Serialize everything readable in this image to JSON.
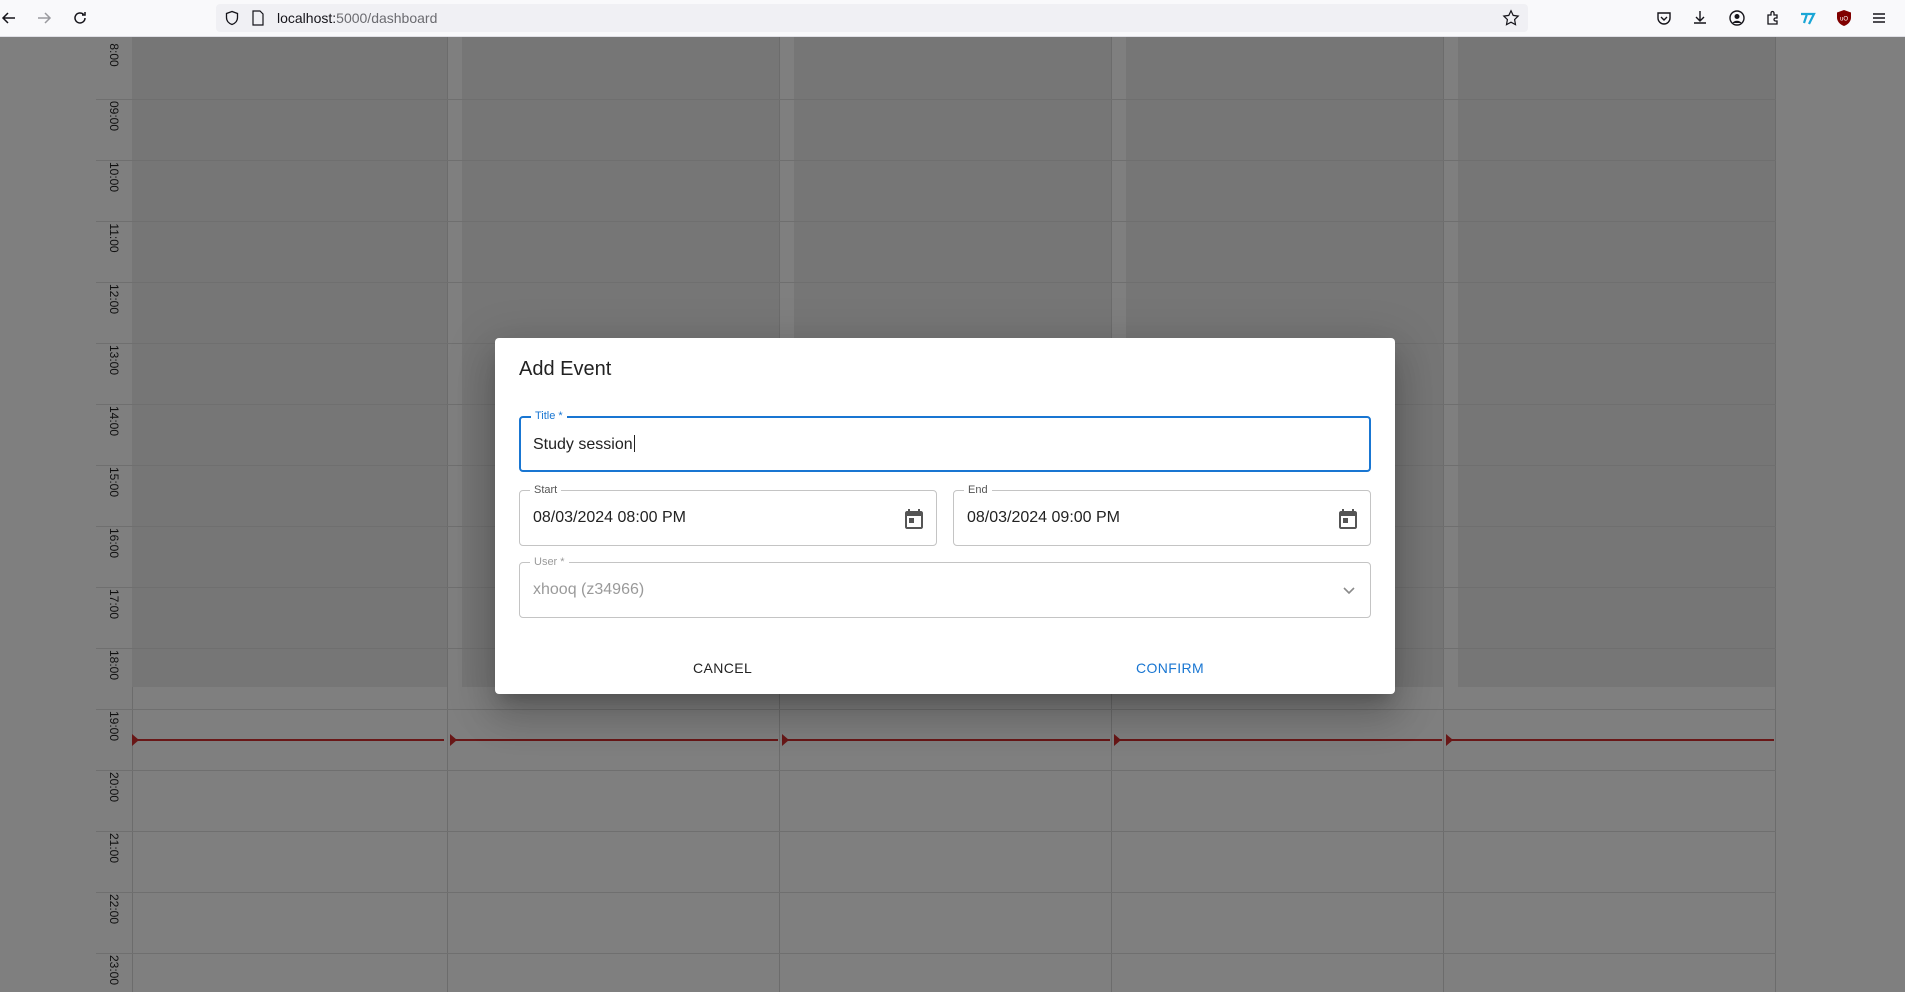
{
  "browser": {
    "url_host": "localhost:",
    "url_path": "5000/dashboard",
    "icons": [
      "back-icon",
      "forward-icon",
      "reload-icon",
      "shield-icon",
      "page-icon",
      "star-icon",
      "pocket-icon",
      "download-icon",
      "account-icon",
      "extensions-icon",
      "extension-icon",
      "ublock-icon",
      "menu-icon"
    ]
  },
  "calendar": {
    "hours": [
      "8:00",
      "09:00",
      "10:00",
      "11:00",
      "12:00",
      "13:00",
      "14:00",
      "15:00",
      "16:00",
      "17:00",
      "18:00",
      "19:00",
      "20:00",
      "21:00",
      "22:00",
      "23:00"
    ],
    "day_columns": 5
  },
  "dialog": {
    "title": "Add Event",
    "title_field": {
      "label": "Title *",
      "value": "Study session"
    },
    "start_field": {
      "label": "Start",
      "value": "08/03/2024 08:00 PM"
    },
    "end_field": {
      "label": "End",
      "value": "08/03/2024 09:00 PM"
    },
    "user_field": {
      "label": "User *",
      "value": "xhooq (z34966)"
    },
    "cancel_label": "CANCEL",
    "confirm_label": "CONFIRM"
  },
  "colors": {
    "accent": "#1976d2",
    "now_indicator": "#d32f2f"
  }
}
